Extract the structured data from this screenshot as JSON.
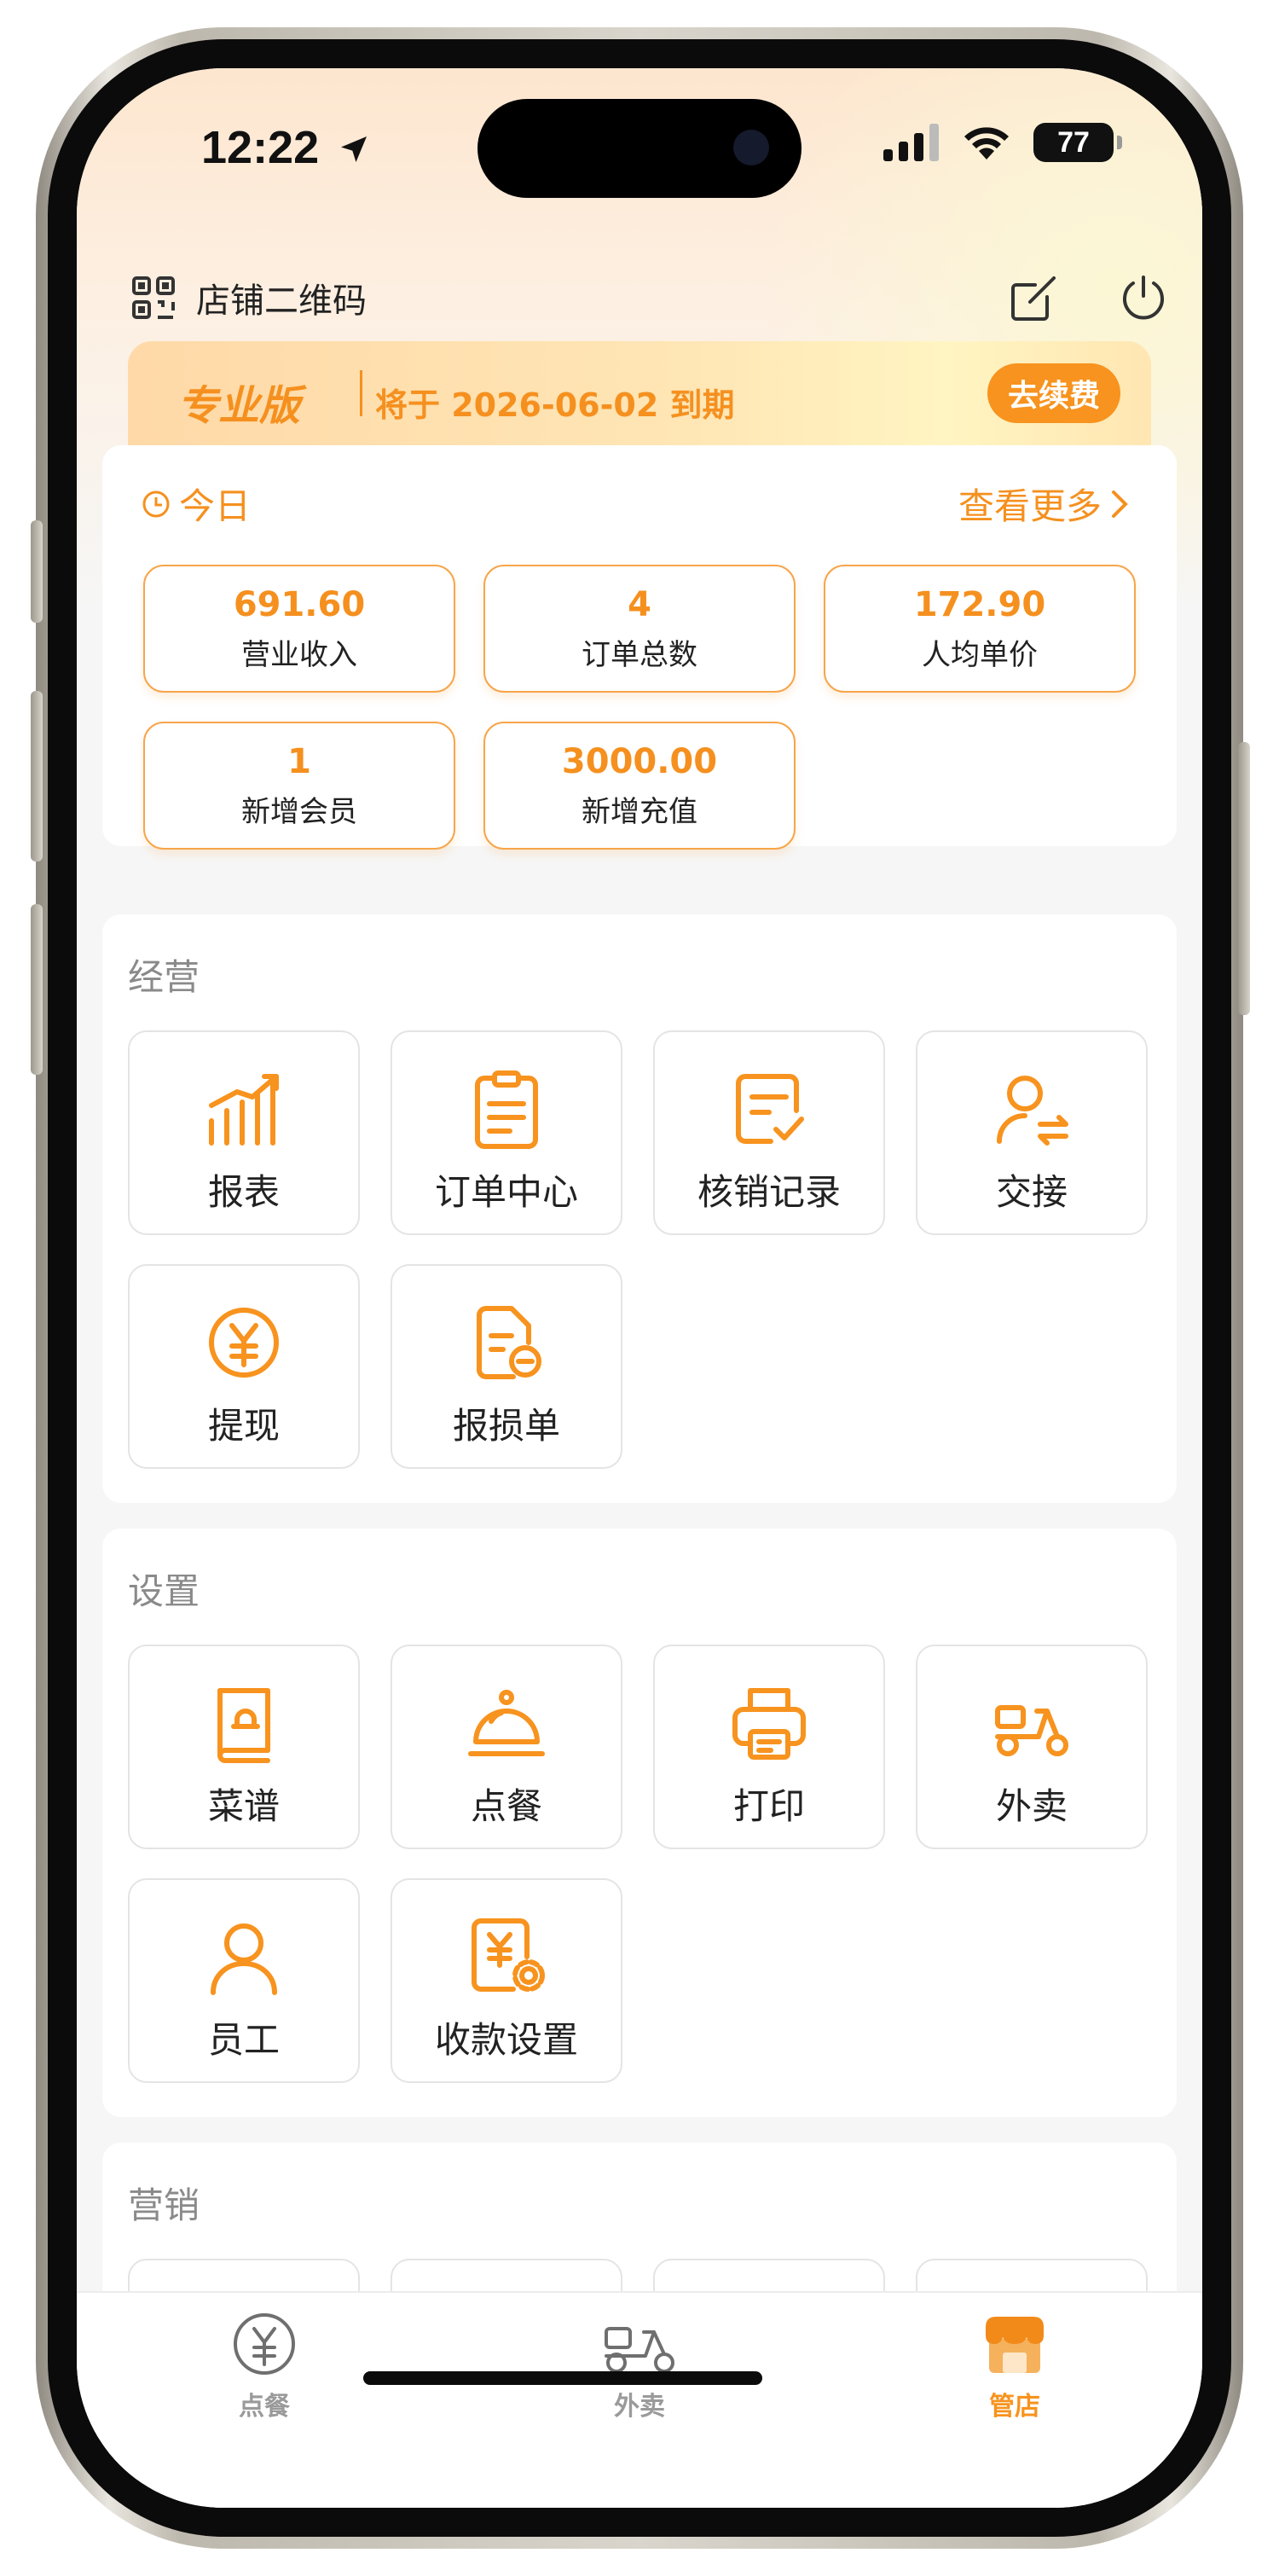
{
  "status_bar": {
    "time": "12:22",
    "battery": "77"
  },
  "header": {
    "qr_label": "店铺二维码"
  },
  "banner": {
    "edition": "专业版",
    "expire": "将于 2026-06-02 到期",
    "renew": "去续费"
  },
  "today": {
    "title": "今日",
    "more": "查看更多",
    "stats": [
      {
        "value": "691.60",
        "label": "营业收入"
      },
      {
        "value": "4",
        "label": "订单总数"
      },
      {
        "value": "172.90",
        "label": "人均单价"
      },
      {
        "value": "1",
        "label": "新增会员"
      },
      {
        "value": "3000.00",
        "label": "新增充值"
      }
    ]
  },
  "operations": {
    "title": "经营",
    "items": [
      {
        "label": "报表",
        "icon": "chart-icon"
      },
      {
        "label": "订单中心",
        "icon": "clipboard-icon"
      },
      {
        "label": "核销记录",
        "icon": "checklist-icon"
      },
      {
        "label": "交接",
        "icon": "user-swap-icon"
      },
      {
        "label": "提现",
        "icon": "yuan-coin-icon"
      },
      {
        "label": "报损单",
        "icon": "document-minus-icon"
      }
    ]
  },
  "settings": {
    "title": "设置",
    "items": [
      {
        "label": "菜谱",
        "icon": "menu-book-icon"
      },
      {
        "label": "点餐",
        "icon": "cloche-icon"
      },
      {
        "label": "打印",
        "icon": "printer-icon"
      },
      {
        "label": "外卖",
        "icon": "scooter-icon"
      },
      {
        "label": "员工",
        "icon": "user-icon"
      },
      {
        "label": "收款设置",
        "icon": "payment-settings-icon"
      }
    ]
  },
  "marketing": {
    "title": "营销"
  },
  "tabbar": {
    "items": [
      {
        "label": "点餐",
        "icon": "yuan-icon",
        "active": false
      },
      {
        "label": "外卖",
        "icon": "scooter-icon",
        "active": false
      },
      {
        "label": "管店",
        "icon": "store-icon",
        "active": true
      }
    ]
  },
  "colors": {
    "accent": "#f7931e",
    "text": "#222222",
    "muted": "#8a8a8a",
    "inactive_tab": "#9a9a9a"
  }
}
